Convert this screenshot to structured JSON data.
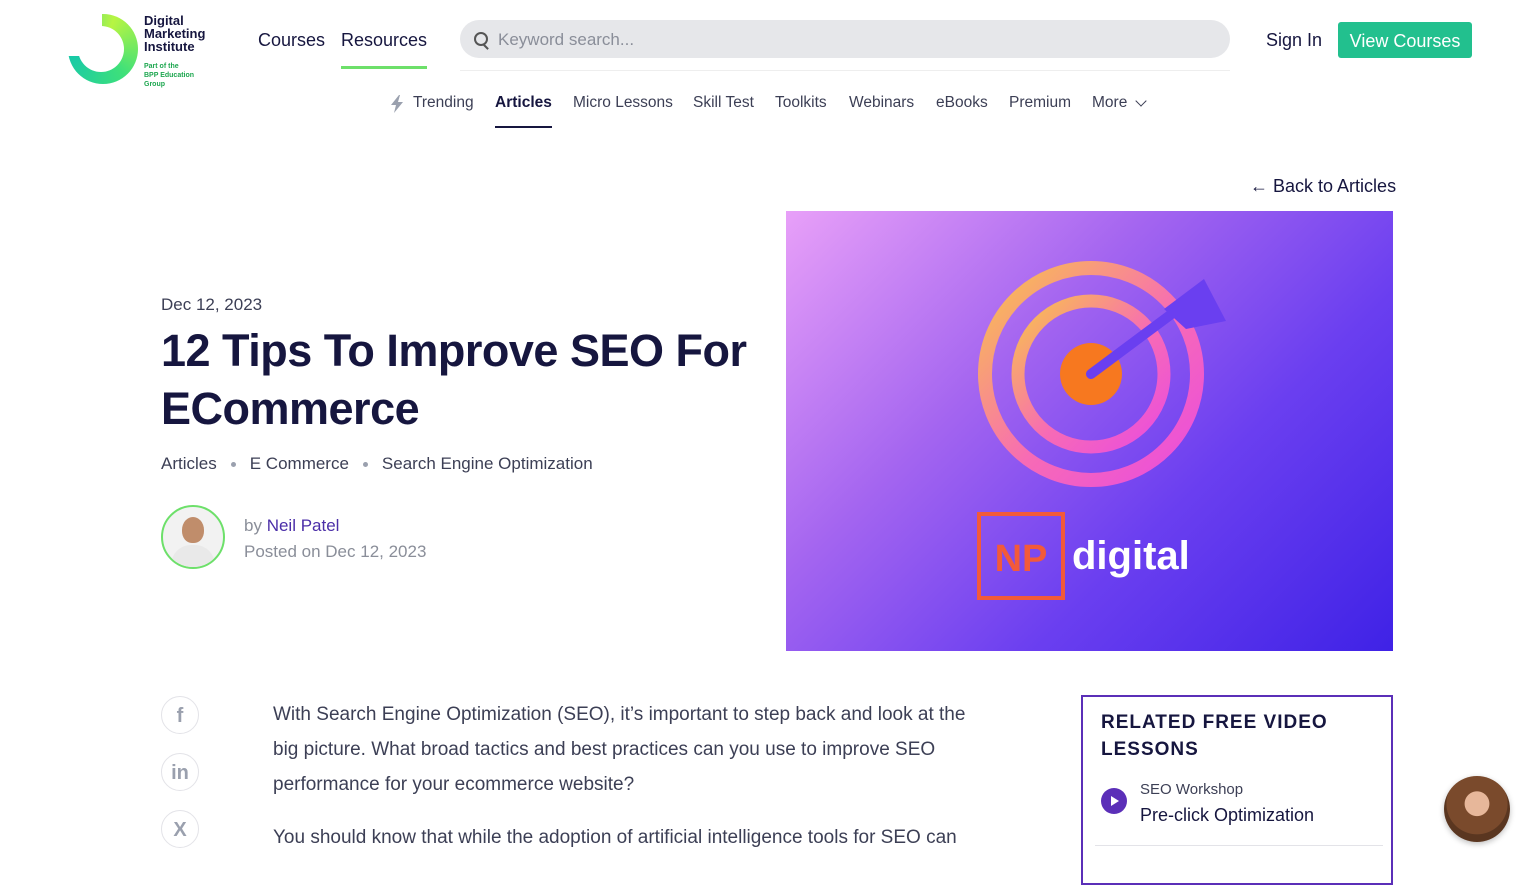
{
  "brand": {
    "name_lines": [
      "Digital",
      "Marketing",
      "Institute"
    ],
    "sub_lines": [
      "Part of the",
      "BPP Education",
      "Group"
    ],
    "colors": {
      "green": "#22c08e",
      "navy": "#16163f",
      "purple": "#5b2fb8"
    }
  },
  "top_nav": {
    "courses": "Courses",
    "resources": "Resources"
  },
  "search": {
    "placeholder": "Keyword search..."
  },
  "header_actions": {
    "sign_in": "Sign In",
    "view_courses": "View Courses"
  },
  "sub_nav": {
    "trending": "Trending",
    "articles": "Articles",
    "micro_lessons": "Micro Lessons",
    "skill_test": "Skill Test",
    "toolkits": "Toolkits",
    "webinars": "Webinars",
    "ebooks": "eBooks",
    "premium": "Premium",
    "more": "More"
  },
  "back_link": "Back to Articles",
  "article": {
    "date": "Dec 12, 2023",
    "title": "12 Tips To Improve SEO For ECommerce",
    "tags": [
      "Articles",
      "E Commerce",
      "Search Engine Optimization"
    ],
    "by_label": "by",
    "author": "Neil Patel",
    "posted": "Posted on Dec 12, 2023",
    "hero_logo_np": "NP",
    "hero_logo_word": "digital",
    "paragraphs": [
      "With Search Engine Optimization (SEO), it’s important to step back and look at the big picture. What broad tactics and best practices can you use to improve SEO performance for your ecommerce website?",
      "You should know that while the adoption of artificial intelligence tools for SEO can"
    ]
  },
  "share": {
    "facebook": "f",
    "linkedin": "in",
    "x": "X"
  },
  "related": {
    "title": "RELATED FREE VIDEO LESSONS",
    "items": [
      {
        "kicker": "SEO Workshop",
        "title": "Pre-click Optimization"
      }
    ]
  }
}
